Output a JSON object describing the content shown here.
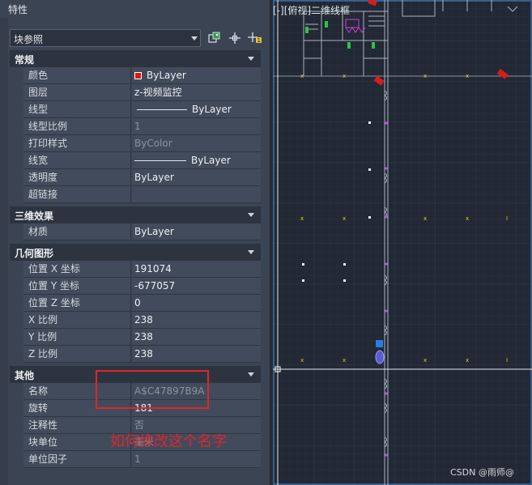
{
  "palette": {
    "title": "特性",
    "object_type": "块参照"
  },
  "sections": {
    "general": {
      "label": "常规",
      "rows": [
        {
          "name": "颜色",
          "value": "ByLayer"
        },
        {
          "name": "图层",
          "value": "z-视频监控"
        },
        {
          "name": "线型",
          "value": "ByLayer"
        },
        {
          "name": "线型比例",
          "value": "1"
        },
        {
          "name": "打印样式",
          "value": "ByColor"
        },
        {
          "name": "线宽",
          "value": "ByLayer"
        },
        {
          "name": "透明度",
          "value": "ByLayer"
        },
        {
          "name": "超链接",
          "value": ""
        }
      ]
    },
    "effects3d": {
      "label": "三维效果",
      "rows": [
        {
          "name": "材质",
          "value": "ByLayer"
        }
      ]
    },
    "geometry": {
      "label": "几何图形",
      "rows": [
        {
          "name": "位置 X 坐标",
          "value": "191074"
        },
        {
          "name": "位置 Y 坐标",
          "value": "-677057"
        },
        {
          "name": "位置 Z 坐标",
          "value": "0"
        },
        {
          "name": "X 比例",
          "value": "238"
        },
        {
          "name": "Y 比例",
          "value": "238"
        },
        {
          "name": "Z 比例",
          "value": "238"
        }
      ]
    },
    "misc": {
      "label": "其他",
      "rows": [
        {
          "name": "名称",
          "value": "A$C47897B9A"
        },
        {
          "name": "旋转",
          "value": "181"
        },
        {
          "name": "注释性",
          "value": "否"
        },
        {
          "name": "块单位",
          "value": "毫米"
        },
        {
          "name": "单位因子",
          "value": "1"
        }
      ]
    }
  },
  "annotation": "如何修改这个名字",
  "viewport": {
    "label": "[-][俯视]二维线框"
  },
  "watermark": "CSDN @雨师@",
  "colors": {
    "accent_red": "#e1262a",
    "color_swatch": "#e11212",
    "cursor_blue": "#2a7de1"
  },
  "icons": [
    "quick-select-icon",
    "select-objects-icon",
    "toggle-pickadd-icon",
    "collapse-arrow-icon"
  ]
}
